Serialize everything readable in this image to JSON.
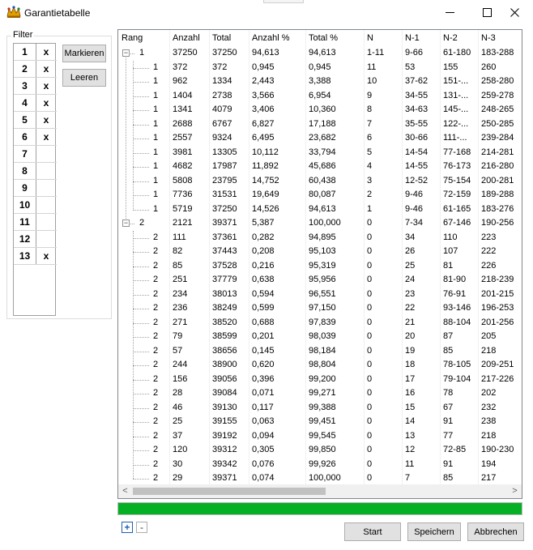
{
  "window": {
    "title": "Garantietabelle",
    "icon": "jester-crown-icon",
    "controls": [
      "minimize-icon",
      "maximize-icon",
      "close-icon"
    ]
  },
  "filter": {
    "label": "Filter",
    "rows": [
      {
        "num": "1",
        "mark": "x"
      },
      {
        "num": "2",
        "mark": "x"
      },
      {
        "num": "3",
        "mark": "x"
      },
      {
        "num": "4",
        "mark": "x"
      },
      {
        "num": "5",
        "mark": "x"
      },
      {
        "num": "6",
        "mark": "x"
      },
      {
        "num": "7",
        "mark": ""
      },
      {
        "num": "8",
        "mark": ""
      },
      {
        "num": "9",
        "mark": ""
      },
      {
        "num": "10",
        "mark": ""
      },
      {
        "num": "11",
        "mark": ""
      },
      {
        "num": "12",
        "mark": ""
      },
      {
        "num": "13",
        "mark": "x"
      }
    ],
    "markieren_label": "Markieren",
    "leeren_label": "Leeren"
  },
  "table": {
    "columns": [
      "Rang",
      "Anzahl",
      "Total",
      "Anzahl %",
      "Total %",
      "N",
      "N-1",
      "N-2",
      "N-3"
    ],
    "rows": [
      {
        "level": 0,
        "expander": "−",
        "cells": [
          "1",
          "37250",
          "37250",
          "94,613",
          "94,613",
          "1-11",
          "9-66",
          "61-180",
          "183-288"
        ]
      },
      {
        "level": 1,
        "cells": [
          "1",
          "372",
          "372",
          "0,945",
          "0,945",
          "11",
          "53",
          "155",
          "260"
        ]
      },
      {
        "level": 1,
        "cells": [
          "1",
          "962",
          "1334",
          "2,443",
          "3,388",
          "10",
          "37-62",
          "151-...",
          "258-280"
        ]
      },
      {
        "level": 1,
        "cells": [
          "1",
          "1404",
          "2738",
          "3,566",
          "6,954",
          "9",
          "34-55",
          "131-...",
          "259-278"
        ]
      },
      {
        "level": 1,
        "cells": [
          "1",
          "1341",
          "4079",
          "3,406",
          "10,360",
          "8",
          "34-63",
          "145-...",
          "248-265"
        ]
      },
      {
        "level": 1,
        "cells": [
          "1",
          "2688",
          "6767",
          "6,827",
          "17,188",
          "7",
          "35-55",
          "122-...",
          "250-285"
        ]
      },
      {
        "level": 1,
        "cells": [
          "1",
          "2557",
          "9324",
          "6,495",
          "23,682",
          "6",
          "30-66",
          "111-...",
          "239-284"
        ]
      },
      {
        "level": 1,
        "cells": [
          "1",
          "3981",
          "13305",
          "10,112",
          "33,794",
          "5",
          "14-54",
          "77-168",
          "214-281"
        ]
      },
      {
        "level": 1,
        "cells": [
          "1",
          "4682",
          "17987",
          "11,892",
          "45,686",
          "4",
          "14-55",
          "76-173",
          "216-280"
        ]
      },
      {
        "level": 1,
        "cells": [
          "1",
          "5808",
          "23795",
          "14,752",
          "60,438",
          "3",
          "12-52",
          "75-154",
          "200-281"
        ]
      },
      {
        "level": 1,
        "cells": [
          "1",
          "7736",
          "31531",
          "19,649",
          "80,087",
          "2",
          "9-46",
          "72-159",
          "189-288"
        ]
      },
      {
        "level": 1,
        "cells": [
          "1",
          "5719",
          "37250",
          "14,526",
          "94,613",
          "1",
          "9-46",
          "61-165",
          "183-276"
        ]
      },
      {
        "level": 0,
        "expander": "−",
        "cells": [
          "2",
          "2121",
          "39371",
          "5,387",
          "100,000",
          "0",
          "7-34",
          "67-146",
          "190-256"
        ]
      },
      {
        "level": 1,
        "cells": [
          "2",
          "111",
          "37361",
          "0,282",
          "94,895",
          "0",
          "34",
          "110",
          "223"
        ]
      },
      {
        "level": 1,
        "cells": [
          "2",
          "82",
          "37443",
          "0,208",
          "95,103",
          "0",
          "26",
          "107",
          "222"
        ]
      },
      {
        "level": 1,
        "cells": [
          "2",
          "85",
          "37528",
          "0,216",
          "95,319",
          "0",
          "25",
          "81",
          "226"
        ]
      },
      {
        "level": 1,
        "cells": [
          "2",
          "251",
          "37779",
          "0,638",
          "95,956",
          "0",
          "24",
          "81-90",
          "218-239"
        ]
      },
      {
        "level": 1,
        "cells": [
          "2",
          "234",
          "38013",
          "0,594",
          "96,551",
          "0",
          "23",
          "76-91",
          "201-215"
        ]
      },
      {
        "level": 1,
        "cells": [
          "2",
          "236",
          "38249",
          "0,599",
          "97,150",
          "0",
          "22",
          "93-146",
          "196-253"
        ]
      },
      {
        "level": 1,
        "cells": [
          "2",
          "271",
          "38520",
          "0,688",
          "97,839",
          "0",
          "21",
          "88-104",
          "201-256"
        ]
      },
      {
        "level": 1,
        "cells": [
          "2",
          "79",
          "38599",
          "0,201",
          "98,039",
          "0",
          "20",
          "87",
          "205"
        ]
      },
      {
        "level": 1,
        "cells": [
          "2",
          "57",
          "38656",
          "0,145",
          "98,184",
          "0",
          "19",
          "85",
          "218"
        ]
      },
      {
        "level": 1,
        "cells": [
          "2",
          "244",
          "38900",
          "0,620",
          "98,804",
          "0",
          "18",
          "78-105",
          "209-251"
        ]
      },
      {
        "level": 1,
        "cells": [
          "2",
          "156",
          "39056",
          "0,396",
          "99,200",
          "0",
          "17",
          "79-104",
          "217-226"
        ]
      },
      {
        "level": 1,
        "cells": [
          "2",
          "28",
          "39084",
          "0,071",
          "99,271",
          "0",
          "16",
          "78",
          "202"
        ]
      },
      {
        "level": 1,
        "cells": [
          "2",
          "46",
          "39130",
          "0,117",
          "99,388",
          "0",
          "15",
          "67",
          "232"
        ]
      },
      {
        "level": 1,
        "cells": [
          "2",
          "25",
          "39155",
          "0,063",
          "99,451",
          "0",
          "14",
          "91",
          "238"
        ]
      },
      {
        "level": 1,
        "cells": [
          "2",
          "37",
          "39192",
          "0,094",
          "99,545",
          "0",
          "13",
          "77",
          "218"
        ]
      },
      {
        "level": 1,
        "cells": [
          "2",
          "120",
          "39312",
          "0,305",
          "99,850",
          "0",
          "12",
          "72-85",
          "190-230"
        ]
      },
      {
        "level": 1,
        "cells": [
          "2",
          "30",
          "39342",
          "0,076",
          "99,926",
          "0",
          "11",
          "91",
          "194"
        ]
      },
      {
        "level": 1,
        "cells": [
          "2",
          "29",
          "39371",
          "0,074",
          "100,000",
          "0",
          "7",
          "85",
          "217"
        ]
      }
    ],
    "scroll_left_arrow": "<",
    "scroll_right_arrow": ">"
  },
  "progress": {
    "percent": 100,
    "color": "#06b025"
  },
  "tree_controls": {
    "expand_label": "+",
    "collapse_label": "-"
  },
  "buttons": {
    "start": "Start",
    "speichern": "Speichern",
    "abbrechen": "Abbrechen"
  }
}
